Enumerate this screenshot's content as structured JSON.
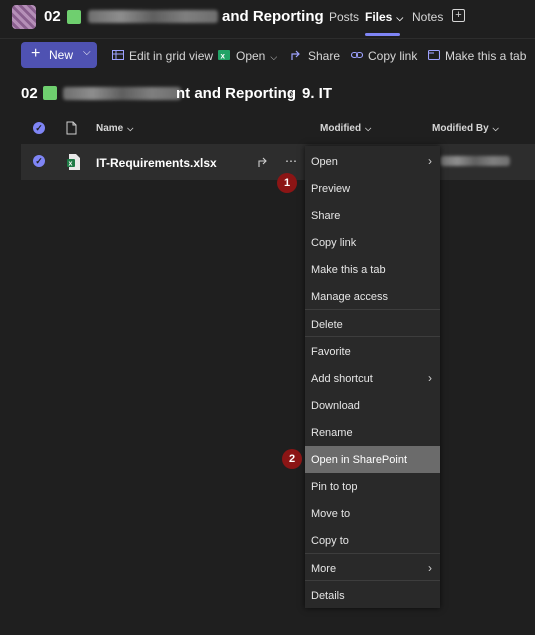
{
  "header": {
    "team_number": "02",
    "team_title_visible": "and Reporting",
    "tabs": [
      {
        "label": "Posts"
      },
      {
        "label": "Files"
      },
      {
        "label": "Notes"
      }
    ],
    "add_tab_label": "+"
  },
  "toolbar": {
    "new_label": "New",
    "edit_grid_label": "Edit in grid view",
    "open_label": "Open",
    "share_label": "Share",
    "copy_link_label": "Copy link",
    "make_tab_label": "Make this a tab"
  },
  "breadcrumb": {
    "team_number": "02",
    "team_title_visible": "nt and Reporting",
    "separator": "›",
    "current": "9. IT"
  },
  "list": {
    "columns": [
      "Name",
      "Modified",
      "Modified By"
    ],
    "rows": [
      {
        "name": "IT-Requirements.xlsx"
      }
    ]
  },
  "context_menu": {
    "items": [
      {
        "label": "Open",
        "submenu": true
      },
      {
        "label": "Preview"
      },
      {
        "label": "Share"
      },
      {
        "label": "Copy link"
      },
      {
        "label": "Make this a tab"
      },
      {
        "label": "Manage access"
      },
      {
        "label": "Delete"
      },
      {
        "label": "Favorite"
      },
      {
        "label": "Add shortcut",
        "submenu": true
      },
      {
        "label": "Download"
      },
      {
        "label": "Rename"
      },
      {
        "label": "Open in SharePoint",
        "highlighted": true
      },
      {
        "label": "Pin to top"
      },
      {
        "label": "Move to"
      },
      {
        "label": "Copy to"
      },
      {
        "label": "More",
        "submenu": true
      },
      {
        "label": "Details"
      }
    ]
  },
  "annotations": [
    {
      "number": "1"
    },
    {
      "number": "2"
    }
  ],
  "colors": {
    "background": "#1f1f1f",
    "accent": "#7f85f5",
    "new_button": "#4f52b2",
    "menu_bg": "#292929",
    "highlight": "#6b6b6b",
    "badge": "#8b1515",
    "folder_green": "#6fcf6f"
  }
}
